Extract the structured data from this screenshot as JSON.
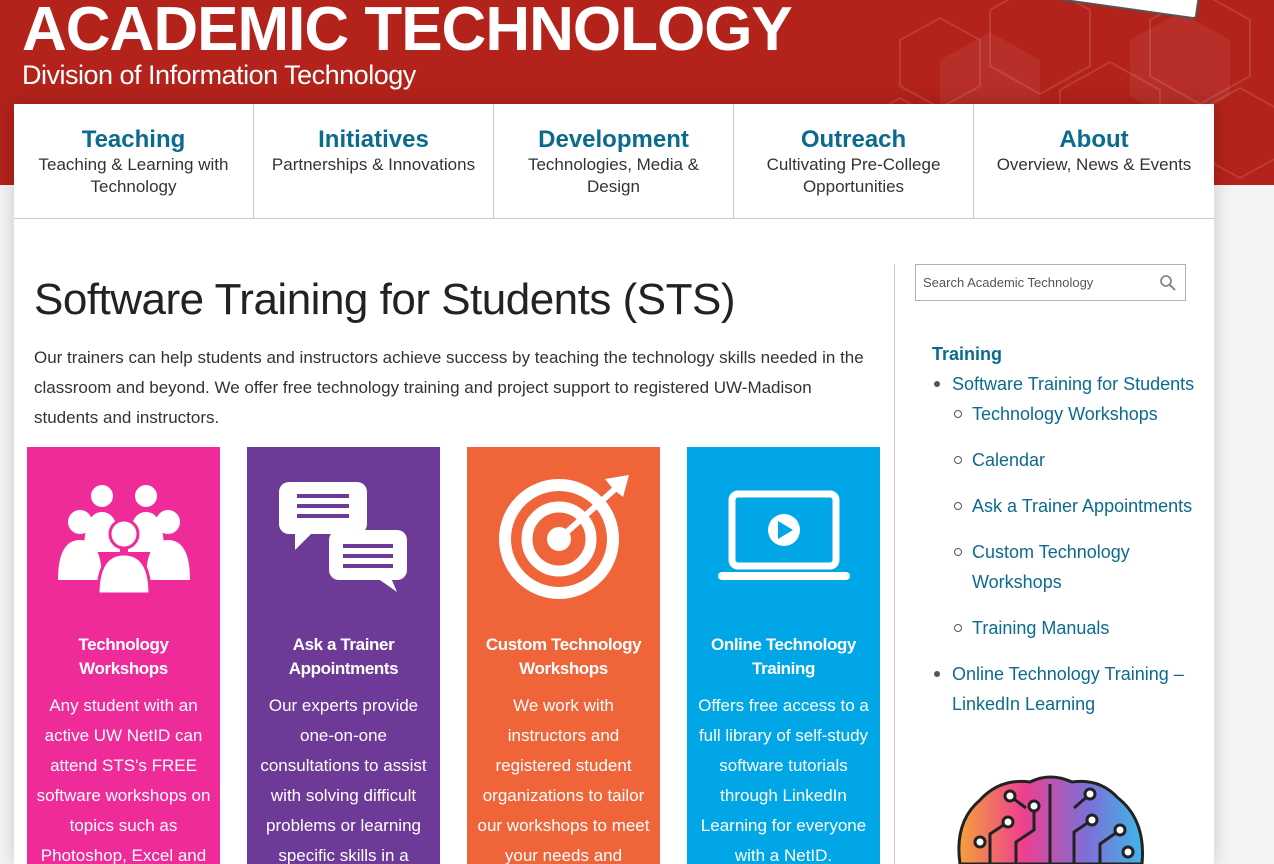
{
  "site": {
    "title": "ACADEMIC TECHNOLOGY",
    "subtitle": "Division of Information Technology",
    "brand_color": "#b3221b"
  },
  "nav": [
    {
      "title": "Teaching",
      "desc": "Teaching & Learning with Technology"
    },
    {
      "title": "Initiatives",
      "desc": "Partnerships & Innovations"
    },
    {
      "title": "Development",
      "desc": "Technologies, Media & Design"
    },
    {
      "title": "Outreach",
      "desc": "Cultivating Pre-College Opportunities"
    },
    {
      "title": "About",
      "desc": "Overview, News & Events"
    }
  ],
  "main": {
    "title": "Software Training for Students (STS)",
    "intro": "Our trainers can help students and instructors achieve success by teaching the technology skills needed in the classroom and beyond. We offer free technology training and project support to registered UW-Madison students and instructors."
  },
  "cards": [
    {
      "icon": "people-group-icon",
      "color": "#ef2a99",
      "title": "Technology Workshops",
      "text": "Any student with an active UW NetID can attend STS's FREE software workshops on topics such as Photoshop, Excel and HTML."
    },
    {
      "icon": "chat-bubbles-icon",
      "color": "#6e3a97",
      "title": "Ask a Trainer Appointments",
      "text": "Our experts provide one-on-one consultations to assist with solving difficult problems or learning specific skills in a software."
    },
    {
      "icon": "target-icon",
      "color": "#f0643a",
      "title": "Custom Technology Workshops",
      "text": "We work with instructors and registered student organizations to tailor our workshops to meet your needs and schedule."
    },
    {
      "icon": "laptop-play-icon",
      "color": "#00a6e6",
      "title": "Online Technology Training",
      "text": "Offers free access to a full library of self-study software tutorials through LinkedIn Learning for everyone with a NetID."
    }
  ],
  "search": {
    "placeholder": "Search Academic Technology"
  },
  "sidebar": {
    "heading": "Training",
    "items": [
      {
        "label": "Software Training for Students"
      },
      {
        "label": "Technology Workshops"
      },
      {
        "label": "Calendar"
      },
      {
        "label": "Ask a Trainer Appointments"
      },
      {
        "label": "Custom Technology Workshops"
      },
      {
        "label": "Training Manuals"
      },
      {
        "label": "Online Technology Training – LinkedIn Learning"
      }
    ]
  },
  "colors": {
    "link": "#0b6b8f"
  }
}
